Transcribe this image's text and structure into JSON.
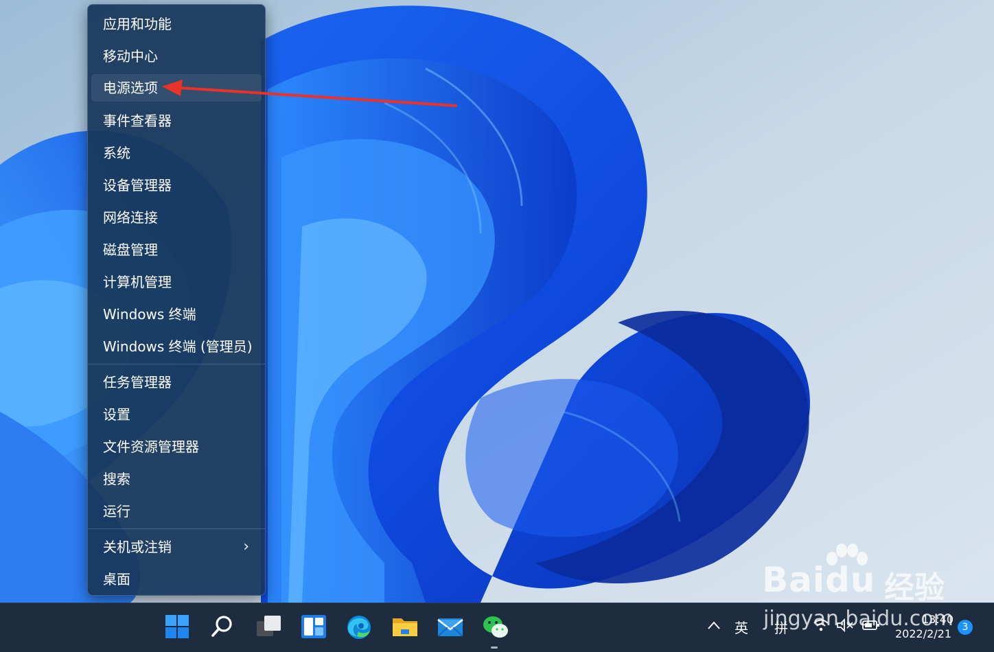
{
  "context_menu": {
    "items": [
      {
        "label": "应用和功能"
      },
      {
        "label": "移动中心"
      },
      {
        "label": "电源选项"
      },
      {
        "label": "事件查看器"
      },
      {
        "label": "系统"
      },
      {
        "label": "设备管理器"
      },
      {
        "label": "网络连接"
      },
      {
        "label": "磁盘管理"
      },
      {
        "label": "计算机管理"
      },
      {
        "label": "Windows 终端"
      },
      {
        "label": "Windows 终端 (管理员)"
      },
      {
        "label": "任务管理器"
      },
      {
        "label": "设置"
      },
      {
        "label": "文件资源管理器"
      },
      {
        "label": "搜索"
      },
      {
        "label": "运行"
      },
      {
        "label": "关机或注销"
      },
      {
        "label": "桌面"
      }
    ],
    "highlighted_item": "电源选项",
    "submenu_chevron_icon": "chevron-right-icon"
  },
  "annotation": {
    "color": "#e8322a",
    "points_to": "电源选项"
  },
  "taskbar": {
    "apps": [
      {
        "name": "start",
        "icon": "windows-start-icon"
      },
      {
        "name": "search",
        "icon": "search-icon"
      },
      {
        "name": "task-view",
        "icon": "task-view-icon"
      },
      {
        "name": "widgets",
        "icon": "widgets-icon"
      },
      {
        "name": "edge",
        "icon": "edge-browser-icon"
      },
      {
        "name": "file-explorer",
        "icon": "folder-icon"
      },
      {
        "name": "mail",
        "icon": "mail-icon"
      },
      {
        "name": "wechat",
        "icon": "wechat-icon",
        "running": true
      }
    ],
    "tray": {
      "overflow_icon": "chevron-up-icon",
      "ime_lang": "英",
      "ime_mode": "拼",
      "wifi_icon": "wifi-icon",
      "volume_icon": "volume-muted-icon",
      "battery_icon": "battery-icon",
      "time": "13:40",
      "date": "2022/2/21",
      "notification_count": "3"
    }
  },
  "watermark": {
    "brand": "Bai",
    "brand_suffix": "du",
    "cn": "经验",
    "url": "jingyan.baidu.com"
  },
  "colors": {
    "menu_bg": "#18375c",
    "taskbar_bg": "#1d2c3e",
    "accent": "#1e90ff",
    "arrow": "#e8322a"
  }
}
